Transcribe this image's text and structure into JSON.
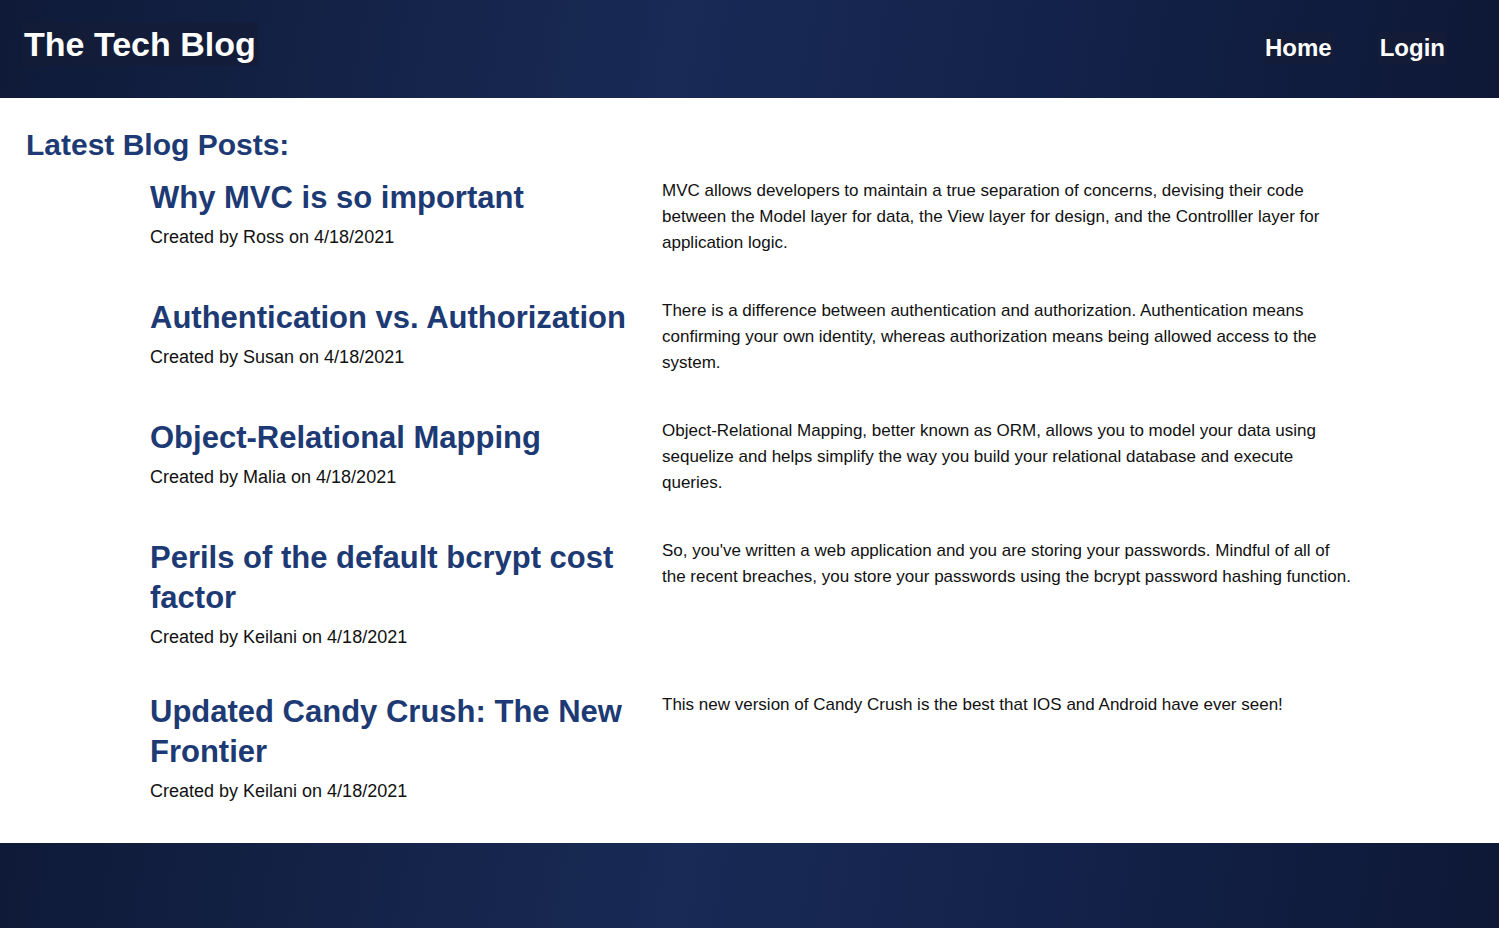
{
  "header": {
    "title": "The Tech Blog",
    "nav": [
      {
        "label": "Home"
      },
      {
        "label": "Login"
      }
    ]
  },
  "heading": "Latest Blog Posts:",
  "posts": [
    {
      "title": "Why MVC is so important",
      "meta": "Created by Ross on 4/18/2021",
      "body": "MVC allows developers to maintain a true separation of concerns, devising their code between the Model layer for data, the View layer for design, and the Controlller layer for application logic."
    },
    {
      "title": "Authentication vs. Authorization",
      "meta": "Created by Susan on 4/18/2021",
      "body": "There is a difference between authentication and authorization. Authentication means confirming your own identity, whereas authorization means being allowed access to the system."
    },
    {
      "title": "Object-Relational Mapping",
      "meta": "Created by Malia on 4/18/2021",
      "body": "Object-Relational Mapping, better known as ORM, allows you to model your data using sequelize and helps simplify the way you build your relational database and execute queries."
    },
    {
      "title": "Perils of the default bcrypt cost factor",
      "meta": "Created by Keilani on 4/18/2021",
      "body": "So, you've written a web application and you are storing your passwords. Mindful of all of the recent breaches, you store your passwords using the bcrypt password hashing function."
    },
    {
      "title": "Updated Candy Crush: The New Frontier",
      "meta": "Created by Keilani on 4/18/2021",
      "body": "This new version of Candy Crush is the best that IOS and Android have ever seen!"
    }
  ]
}
